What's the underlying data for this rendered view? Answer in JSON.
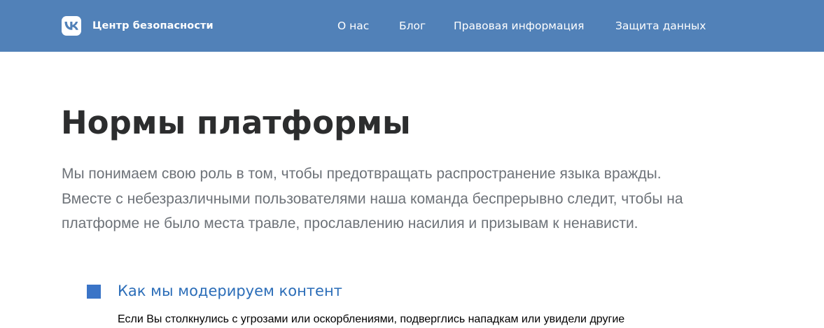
{
  "header": {
    "brand_name": "Центр безопасности",
    "logo_icon": "vk-logo-icon",
    "background_color": "#5181b8",
    "nav": [
      {
        "label": "О нас"
      },
      {
        "label": "Блог"
      },
      {
        "label": "Правовая информация"
      },
      {
        "label": "Защита данных"
      }
    ]
  },
  "main": {
    "title": "Нормы платформы",
    "lead_lines": [
      "Мы понимаем свою роль в том, чтобы предотвращать распространение языка вражды.",
      "Вместе с небезразличными пользователями наша команда беспрерывно следит, чтобы на",
      "платформе не было места травле, прославлению насилия и призывам к ненависти."
    ],
    "section": {
      "title": "Как мы модерируем контент",
      "body": "Если Вы столкнулись с угрозами или оскорблениями, подверглись нападкам или увидели другие",
      "accent_color": "#3a74c7"
    }
  }
}
